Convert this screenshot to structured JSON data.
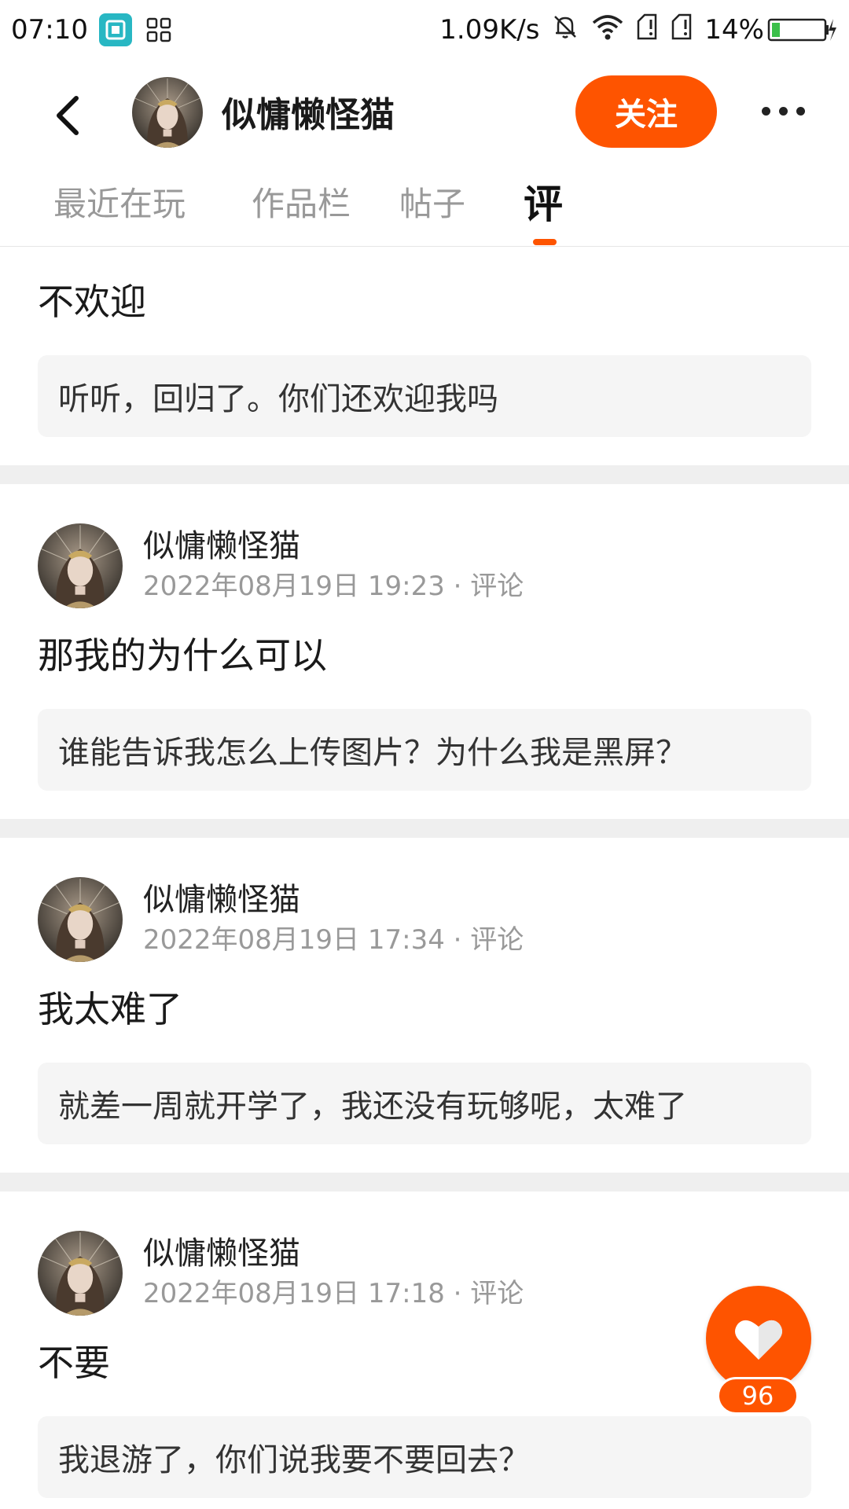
{
  "status_bar": {
    "time": "07:10",
    "net_speed": "1.09K/s",
    "battery": "14%"
  },
  "header": {
    "username": "似慵懒怪猫",
    "follow_label": "关注"
  },
  "tabs": [
    {
      "label": "最近在玩"
    },
    {
      "label": "作品栏"
    },
    {
      "label": "帖子"
    },
    {
      "label": "评"
    }
  ],
  "posts": [
    {
      "title": "不欢迎",
      "quote": "听听，回归了。你们还欢迎我吗"
    },
    {
      "author": "似慵懒怪猫",
      "time": "2022年08月19日 19:23 · 评论",
      "title": "那我的为什么可以",
      "quote": "谁能告诉我怎么上传图片？为什么我是黑屏？"
    },
    {
      "author": "似慵懒怪猫",
      "time": "2022年08月19日 17:34 · 评论",
      "title": "我太难了",
      "quote": "就差一周就开学了，我还没有玩够呢，太难了"
    },
    {
      "author": "似慵懒怪猫",
      "time": "2022年08月19日 17:18 · 评论",
      "title": "不要",
      "quote": "我退游了，你们说我要不要回去？"
    }
  ],
  "like": {
    "count": "96"
  },
  "colors": {
    "accent": "#fe5400",
    "quote_bg": "#f5f5f5",
    "divider": "#efefef"
  },
  "icons": [
    "back-arrow-icon",
    "more-dots-icon",
    "heart-icon",
    "bell-muted-icon",
    "wifi-icon",
    "signal-icon",
    "battery-icon"
  ]
}
